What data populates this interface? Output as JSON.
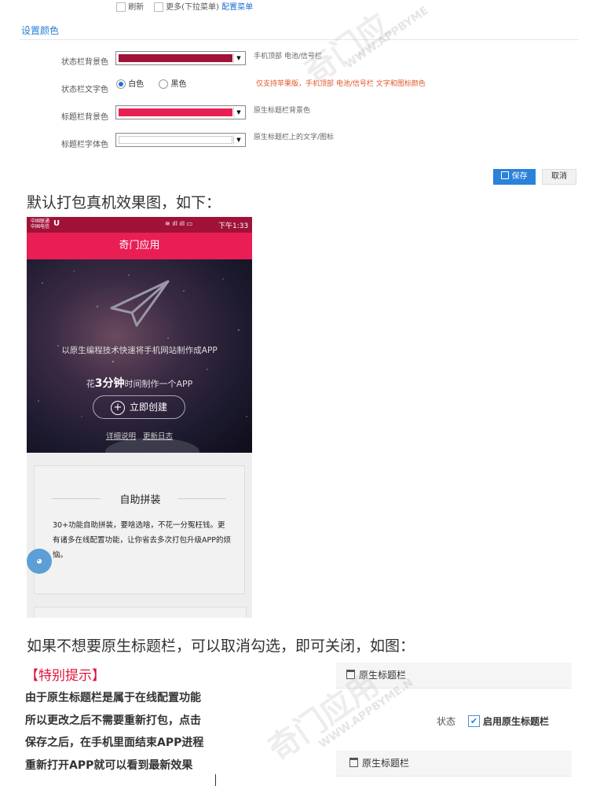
{
  "top_options": {
    "refresh": "刷新",
    "more": "更多(下拉菜单)",
    "config_menu": "配置菜单"
  },
  "section_title": "设置颜色",
  "form": {
    "statusbar_bg_label": "状态栏背景色",
    "statusbar_bg_color": "#a01238",
    "statusbar_bg_hint": "手机顶部 电池/信号栏",
    "statusbar_text_label": "状态栏文字色",
    "radio_white": "白色",
    "radio_black": "黑色",
    "statusbar_text_hint": "仅支持苹果版，手机顶部 电池/信号栏 文字和图标颜色",
    "titlebar_bg_label": "标题栏背景色",
    "titlebar_bg_color": "#e91e55",
    "titlebar_bg_hint": "原生标题栏背景色",
    "titlebar_font_label": "标题栏字体色",
    "titlebar_font_color": "#ffffff",
    "titlebar_font_hint": "原生标题栏上的文字/图标"
  },
  "buttons": {
    "save": "保存",
    "cancel": "取消"
  },
  "heading1": "默认打包真机效果图，如下：",
  "phone": {
    "carrier1": "中国联通",
    "carrier2": "中国电信",
    "time": "下午1:33",
    "app_title": "奇门应用",
    "hero_line1": "以原生编程技术快速将手机网站制作成APP",
    "hero_line2_pre": "花",
    "hero_line2_bold": "3分钟",
    "hero_line2_post": "时间制作一个APP",
    "create_button": "立即创建",
    "link_details": "详细说明",
    "link_changelog": "更新日志",
    "card_title": "自助拼装",
    "card_body": "30+功能自助拼装，要啥选啥，不花一分冤枉钱。更有诸多在线配置功能，让你省去多次打包升级APP的烦恼。"
  },
  "heading2": "如果不想要原生标题栏，可以取消勾选，即可关闭，如图：",
  "tip_title": "【特别提示】",
  "tip_lines": [
    "由于原生标题栏是属于在线配置功能",
    "所以更改之后不需要重新打包，点击",
    "保存之后，在手机里面结束APP进程",
    "重新打开APP就可以看到最新效果"
  ],
  "panel": {
    "header1": "原生标题栏",
    "status_label": "状态",
    "enable_label": "启用原生标题栏",
    "header2": "原生标题栏"
  },
  "watermark": {
    "brand": "奇门应用",
    "url": "WWW.APPBYME"
  }
}
